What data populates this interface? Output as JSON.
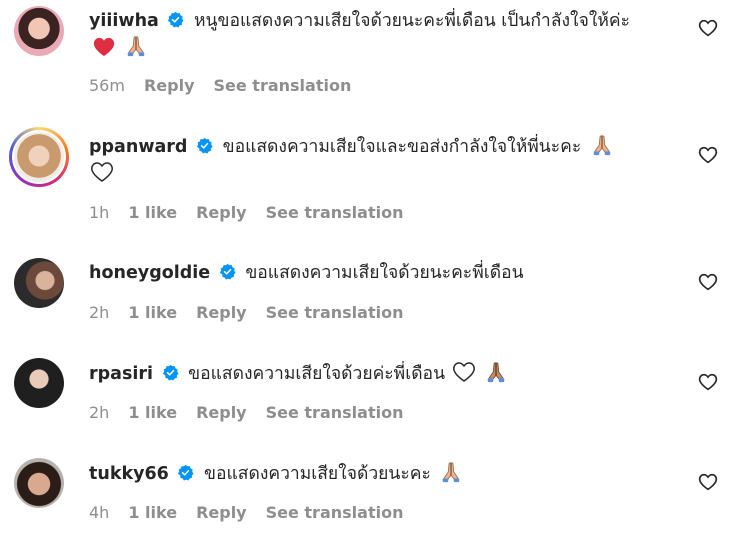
{
  "comments": [
    {
      "username": "yiiiwha",
      "text": "หนูขอแสดงความเสียใจด้วยนะคะพี่เดือน เป็นกำลังใจให้ค่ะ",
      "time": "56m",
      "likes": "",
      "reply": "Reply",
      "translate": "See translation",
      "emojis": [
        "red-heart-icon",
        "folded-hands-icon"
      ]
    },
    {
      "username": "ppanward",
      "text": "ขอแสดงความเสียใจและขอส่งกำลังใจให้พี่นะคะ",
      "time": "1h",
      "likes": "1 like",
      "reply": "Reply",
      "translate": "See translation",
      "emojis": [
        "folded-hands-icon",
        "white-heart-icon"
      ]
    },
    {
      "username": "honeygoldie",
      "text": "ขอแสดงความเสียใจด้วยนะคะพี่เดือน",
      "time": "2h",
      "likes": "1 like",
      "reply": "Reply",
      "translate": "See translation",
      "emojis": []
    },
    {
      "username": "rpasiri",
      "text": "ขอแสดงความเสียใจด้วยค่ะพี่เดือน",
      "time": "2h",
      "likes": "1 like",
      "reply": "Reply",
      "translate": "See translation",
      "emojis": [
        "white-heart-icon",
        "folded-hands-icon"
      ]
    },
    {
      "username": "tukky66",
      "text": "ขอแสดงความเสียใจด้วยนะคะ",
      "time": "4h",
      "likes": "1 like",
      "reply": "Reply",
      "translate": "See translation",
      "emojis": [
        "folded-hands-icon"
      ]
    }
  ],
  "colors": {
    "verified": "#0095f6",
    "meta": "#8e8e8e",
    "text": "#262626",
    "heart": "#ed4956"
  }
}
